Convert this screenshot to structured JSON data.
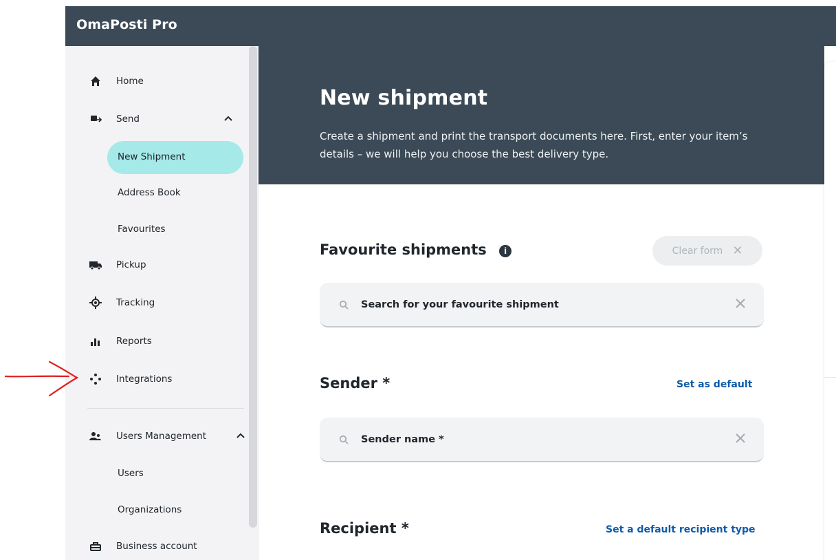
{
  "app": {
    "title": "OmaPosti Pro"
  },
  "sidebar": {
    "items": [
      {
        "label": "Home",
        "icon": "home-icon"
      },
      {
        "label": "Send",
        "icon": "send-parcel-icon",
        "expanded": true
      },
      {
        "label": "Pickup",
        "icon": "truck-icon"
      },
      {
        "label": "Tracking",
        "icon": "target-icon"
      },
      {
        "label": "Reports",
        "icon": "bar-chart-icon"
      },
      {
        "label": "Integrations",
        "icon": "integrations-dots-icon"
      },
      {
        "label": "Users Management",
        "icon": "users-icon",
        "expanded": true
      },
      {
        "label": "Business account",
        "icon": "briefcase-icon"
      }
    ],
    "send_sub": [
      "New Shipment",
      "Address Book",
      "Favourites"
    ],
    "users_sub": [
      "Users",
      "Organizations"
    ],
    "active": "New Shipment"
  },
  "header": {
    "title": "New shipment",
    "description": "Create a shipment and print the transport documents here. First, enter your item’s details – we will help you choose the best delivery type."
  },
  "favourites": {
    "title": "Favourite shipments",
    "clear_label": "Clear form",
    "search_placeholder": "Search for your favourite shipment"
  },
  "sender": {
    "title": "Sender *",
    "link": "Set as default",
    "search_placeholder": "Sender name *"
  },
  "recipient": {
    "title": "Recipient *",
    "link": "Set a default recipient type"
  },
  "colors": {
    "dark_header": "#3b4a56",
    "active_pill": "#a5e9e9",
    "link": "#0f5aa8",
    "annotation": "#e02020"
  }
}
